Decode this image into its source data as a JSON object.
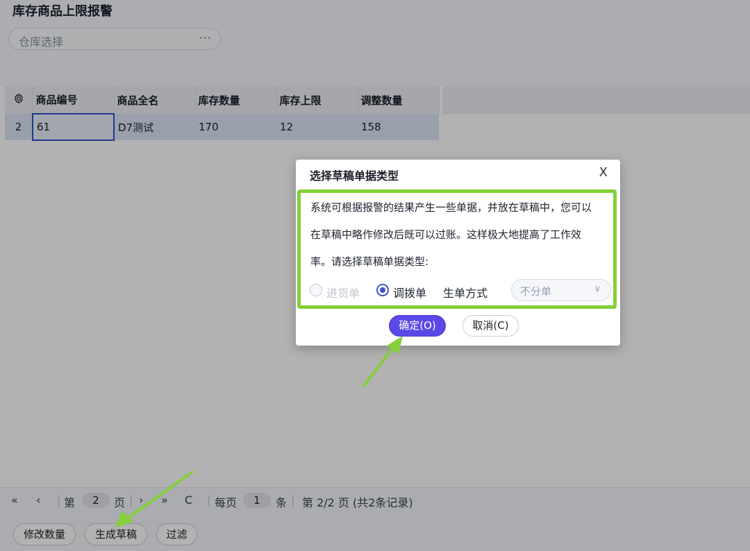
{
  "page": {
    "title": "库存商品上限报警",
    "warehouse_placeholder": "仓库选择",
    "warehouse_more": "···"
  },
  "grid": {
    "columns": [
      "商品编号",
      "商品全名",
      "库存数量",
      "库存上限",
      "调整数量"
    ],
    "rows": [
      {
        "index": "2",
        "code": "61",
        "name": "D7测试",
        "stock": "170",
        "limit": "12",
        "adjust": "158"
      }
    ]
  },
  "pager": {
    "first": "«",
    "prev": "‹",
    "page_prefix": "第",
    "page_num": "2",
    "page_suffix": "页",
    "next": "›",
    "last": "»",
    "refresh": "C",
    "per_page_prefix": "每页",
    "per_page": "1",
    "per_page_suffix": "条",
    "summary": "第 2/2 页 (共2条记录)"
  },
  "footer": {
    "modify_qty": "修改数量",
    "generate_draft": "生成草稿",
    "filter": "过滤"
  },
  "dialog": {
    "title": "选择草稿单据类型",
    "close": "X",
    "message": "系统可根据报警的结果产生一些单据，并放在草稿中，您可以在草稿中略作修改后既可以过账。这样极大地提高了工作效率。请选择草稿单据类型:",
    "option_purchase": "进货单",
    "option_transfer": "调拨单",
    "mode_label": "生单方式",
    "mode_value": "不分单",
    "ok": "确定(O)",
    "cancel": "取消(C)"
  },
  "colors": {
    "accent": "#5a49e6",
    "highlight": "#84cf3a",
    "selection": "#dbe6f6"
  }
}
